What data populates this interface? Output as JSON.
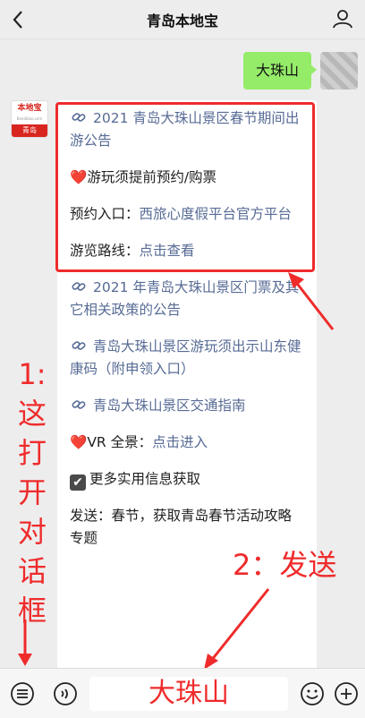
{
  "header": {
    "title": "青岛本地宝"
  },
  "outgoing": {
    "text": "大珠山"
  },
  "incoming_avatar": {
    "brand": "本地宝",
    "site": "Bendibao.com",
    "city": "青岛"
  },
  "message": {
    "link1": "2021 青岛大珠山景区春节期间出游公告",
    "notice_heart": "❤️",
    "notice": "游玩须提前预约/购票",
    "booking_label": "预约入口：",
    "booking_link": "西旅心度假平台官方平台",
    "route_label": "游览路线：",
    "route_link": "点击查看",
    "link2": "2021 年青岛大珠山景区门票及其它相关政策的公告",
    "link3": "青岛大珠山景区游玩须出示山东健康码（附申领入口）",
    "link4": "青岛大珠山景区交通指南",
    "vr_heart": "❤️",
    "vr_label": "VR 全景：",
    "vr_link": "点击进入",
    "more_check": "✔",
    "more": "更多实用信息获取",
    "send_tip": "发送：春节，获取青岛春节活动攻略专题"
  },
  "annotations": {
    "step1": [
      "1:",
      "这",
      "打",
      "开",
      "对",
      "话",
      "框"
    ],
    "step2": "2：发送",
    "color": "#ef2b2b"
  },
  "input": {
    "value": "大珠山"
  },
  "icons": [
    "back-chevron-icon",
    "profile-icon",
    "link-icon",
    "menu-list-icon",
    "voice-icon",
    "emoji-icon",
    "plus-icon"
  ],
  "colors": {
    "bubble_out": "#95ec69",
    "link": "#576b95",
    "bg": "#ededed"
  }
}
